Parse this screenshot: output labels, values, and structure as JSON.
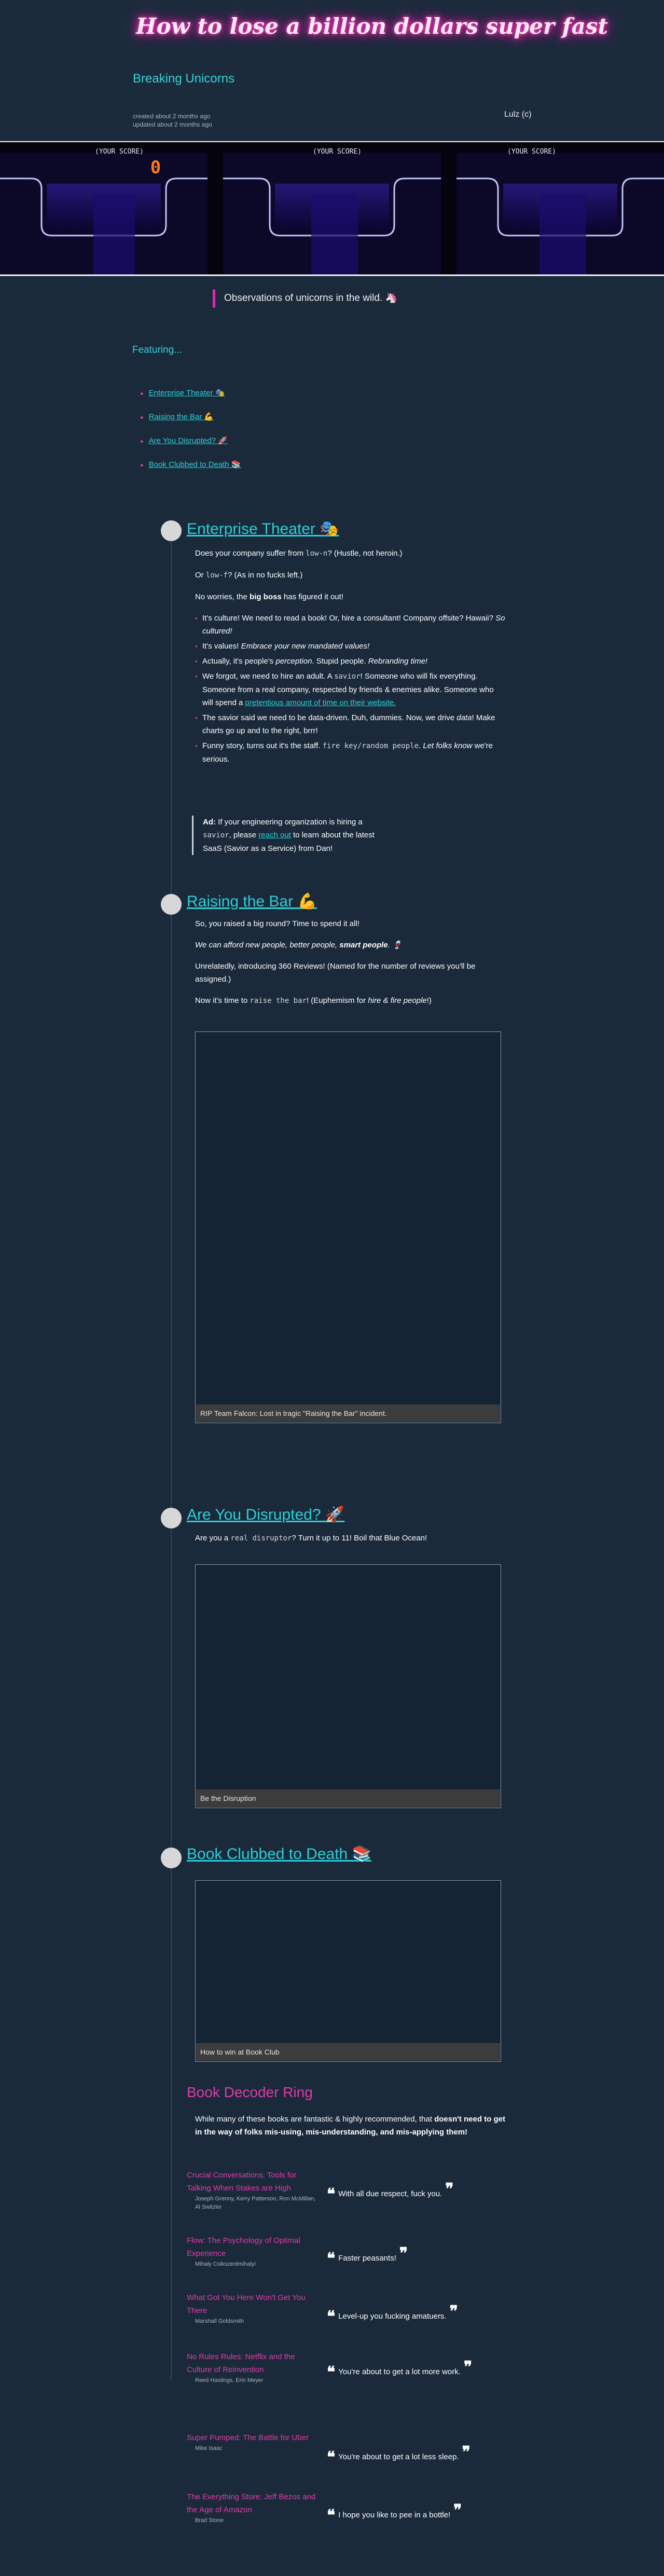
{
  "header": {
    "site_title": "How to lose a billion dollars super fast",
    "subtitle": "Breaking Unicorns",
    "created": "created about 2 months ago",
    "updated": "updated about 2 months ago",
    "author": "Lulz (c)"
  },
  "hero": {
    "panels": [
      "(YOUR SCORE)",
      "(YOUR SCORE)",
      "(YOUR SCORE)"
    ],
    "score": "0"
  },
  "intro": {
    "banner": "Observations of unicorns in the wild. 🦄",
    "featuring": "Featuring..."
  },
  "toc": [
    "Enterprise Theater 🎭",
    "Raising the Bar 💪",
    "Are You Disrupted? 🚀",
    "Book Clubbed to Death 📚"
  ],
  "sections": {
    "enterprise": {
      "title": "Enterprise Theater 🎭",
      "p1_a": "Does your company suffer from ",
      "p1_code": "low-n",
      "p1_b": "? (Hustle, not heroin.)",
      "p2_a": "Or ",
      "p2_code": "low-f",
      "p2_b": "? (As in no fucks left.)",
      "p3_a": "No worries, the ",
      "p3_bold": "big boss",
      "p3_b": " has figured it out!",
      "b1_a": "It's culture! We need to read a book! Or, hire a consultant! Company offsite? Hawaii? ",
      "b1_em": "So cultured!",
      "b2_a": "It's values! ",
      "b2_em": "Embrace your new mandated values!",
      "b3_a": "Actually, it's people's ",
      "b3_em1": "perception",
      "b3_b": ". Stupid people. ",
      "b3_em2": "Rebranding time!",
      "b4_a": "We forgot, we need to hire an adult. A ",
      "b4_code": "savior",
      "b4_b": "! Someone who will fix everything. Someone from a real company, respected by friends & enemies alike. Someone who will spend a ",
      "b4_link": "pretentious amount of time on their website.",
      "b5_a": "The savior said we need to be data-driven. Duh, dummies. Now, we drive ",
      "b5_em": "data",
      "b5_b": "! Make charts go up and to the right, brrr!",
      "b6_a": "Funny story, turns out it's the staff. ",
      "b6_code": "fire key/random people",
      "b6_b": ". ",
      "b6_em": "Let folks know",
      "b6_c": " we're serious.",
      "ad_label": "Ad:",
      "ad_a": " If your engineering organization is hiring a ",
      "ad_code": "savior",
      "ad_b": ", please ",
      "ad_link": "reach out",
      "ad_c": " to learn about the latest SaaS (Savior as a Service) from Dan!"
    },
    "raising": {
      "title": "Raising the Bar 💪",
      "p1": "So, you raised a big round? Time to spend it all!",
      "p2_em": "We can afford new people, better people, ",
      "p2_bold": "smart people",
      "p2_end": ". 🍷",
      "p3": "Unrelatedly, introducing 360 Reviews! (Named for the number of reviews you'll be assigned.)",
      "p4_a": "Now it's time to ",
      "p4_code": "raise the bar",
      "p4_b": "! (Euphemism for ",
      "p4_em": "hire & fire people",
      "p4_c": "!)",
      "caption": "RIP Team Falcon: Lost in tragic \"Raising the Bar\" incident."
    },
    "disrupted": {
      "title": "Are You Disrupted? 🚀",
      "p1_a": "Are you a ",
      "p1_code": "real disruptor",
      "p1_b": "? Turn it up to 11! Boil that Blue Ocean!",
      "caption": "Be the Disruption"
    },
    "book": {
      "title": "Book Clubbed to Death 📚",
      "caption": "How to win at Book Club"
    }
  },
  "decoder": {
    "title": "Book Decoder Ring",
    "intro_a": "While many of these books are fantastic & highly recommended, that ",
    "intro_bold": "doesn't need to get in the way of folks mis-using, mis-understanding, and mis-applying them!",
    "books": [
      {
        "title": "Crucial Conversations: Tools for Talking When Stakes are High",
        "authors": "Joseph Grenny, Kerry Patterson, Ron McMillan, Al Switzler",
        "quote": "With all due respect, fuck you."
      },
      {
        "title": "Flow: The Psychology of Optimal Experience",
        "authors": "Mihaly Csikszentmihalyi",
        "quote": "Faster peasants!"
      },
      {
        "title": "What Got You Here Won't Get You There",
        "authors": "Marshall Goldsmith",
        "quote": "Level-up you fucking amatuers."
      },
      {
        "title": "No Rules Rules: Netflix and the Culture of Reinvention",
        "authors": "Reed Hastings, Erin Meyer",
        "quote": "You're about to get a lot more work."
      },
      {
        "title": "Super Pumped: The Battle for Uber",
        "authors": "Mike Isaac",
        "quote": "You're about to get a lot less sleep."
      },
      {
        "title": "The Everything Store: Jeff Bezos and the Age of Amazon",
        "authors": "Brad Stone",
        "quote": "I hope you like to pee in a bottle!"
      }
    ]
  },
  "colors": {
    "background": "#1b2a3b",
    "accent_cyan": "#29d0d8",
    "accent_pink": "#e03aa8",
    "neon_glow": "#ff2fb5"
  }
}
